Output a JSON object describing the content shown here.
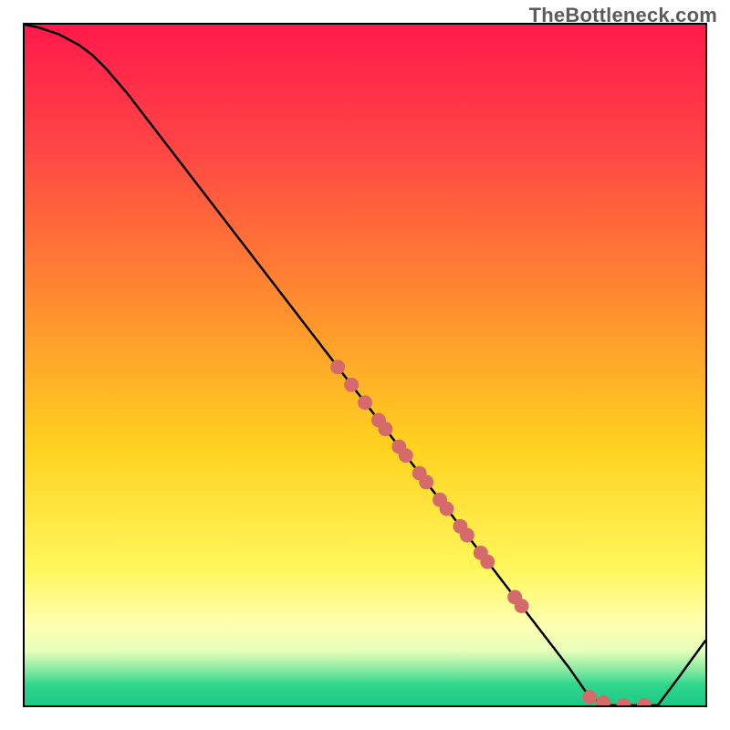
{
  "watermark": "TheBottleneck.com",
  "colors": {
    "gradient_top": "#ff1a4b",
    "gradient_mid": "#ffd21f",
    "gradient_bottom": "#1dc986",
    "curve": "#000000",
    "dot": "#d56a6a"
  },
  "chart_data": {
    "type": "line",
    "title": "",
    "xlabel": "",
    "ylabel": "",
    "xlim": [
      0,
      100
    ],
    "ylim": [
      0,
      100
    ],
    "description": "Bottleneck-style curve: y ≈ 100 at x=0, gentle shoulder until x≈12, then near-linear descent to y≈0 around x≈83, flat floor until x≈93, then rises to y≈10 at x=100. Overlaid salmon dots mark sampled points on the descending segment and along the floor.",
    "series": [
      {
        "name": "curve",
        "x": [
          0,
          2,
          5,
          8,
          10,
          12,
          15,
          20,
          25,
          30,
          35,
          40,
          45,
          50,
          55,
          60,
          65,
          70,
          75,
          80,
          83,
          86,
          90,
          93,
          96,
          100
        ],
        "y": [
          100,
          99.6,
          98.6,
          97.0,
          95.5,
          93.5,
          90.0,
          83.5,
          77.0,
          70.5,
          64.0,
          57.5,
          51.0,
          44.5,
          38.0,
          31.5,
          25.0,
          18.5,
          12.0,
          5.5,
          1.2,
          0.0,
          0.0,
          0.0,
          4.0,
          9.5
        ]
      }
    ],
    "points_on_curve_x": [
      46,
      48,
      50,
      52,
      53,
      55,
      56,
      58,
      59,
      61,
      62,
      64,
      65,
      67,
      68,
      72,
      73
    ],
    "floor_points_x": [
      83,
      85,
      88,
      91
    ],
    "dot_radius_px": 8
  }
}
